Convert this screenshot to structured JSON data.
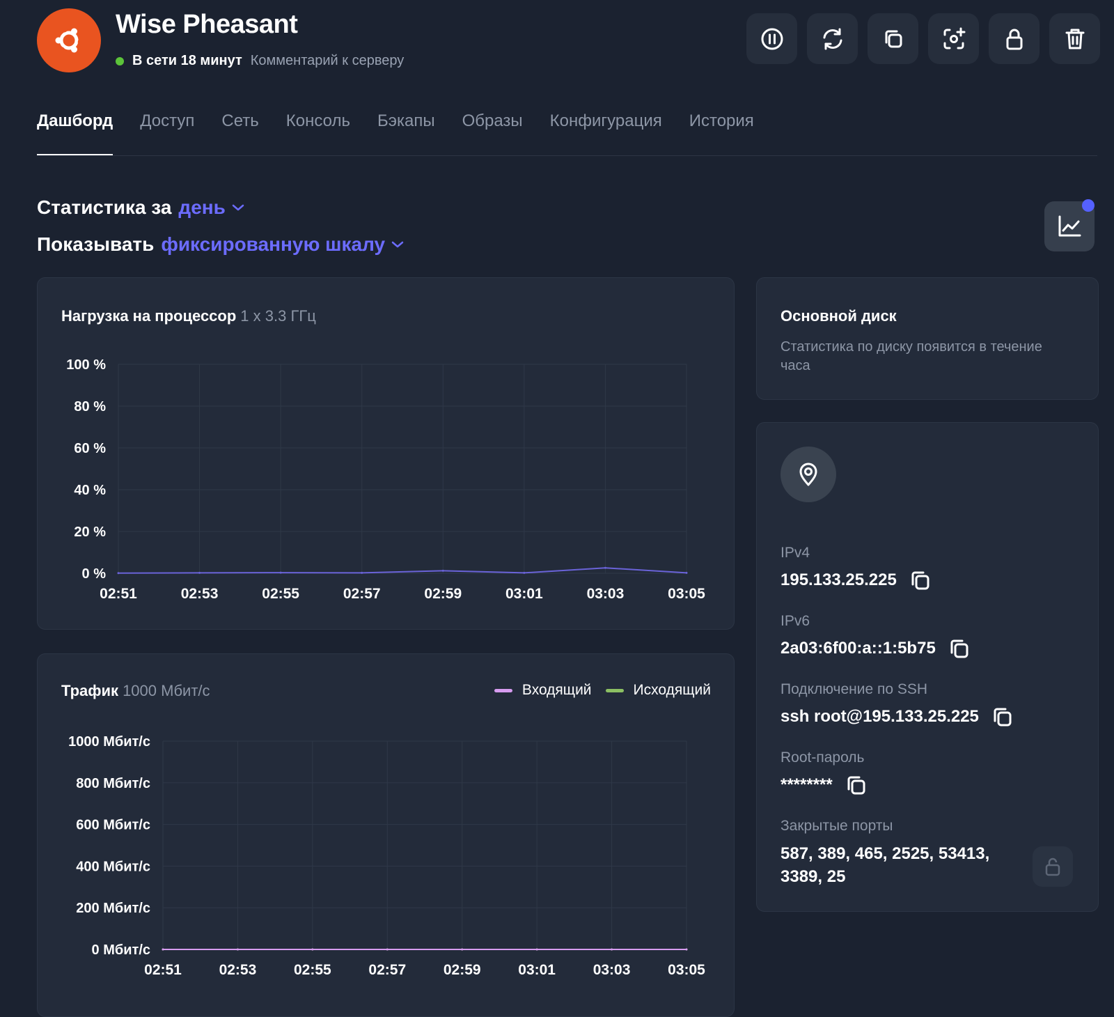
{
  "server": {
    "name": "Wise Pheasant",
    "status_text": "В сети 18 минут",
    "comment_link": "Комментарий к серверу",
    "os_icon": "ubuntu-icon",
    "os_color": "#e95420"
  },
  "toolbar": {
    "icons": [
      "pause-icon",
      "restart-icon",
      "clone-icon",
      "snapshot-icon",
      "lock-icon",
      "trash-icon"
    ]
  },
  "tabs": [
    {
      "label": "Дашборд",
      "active": true
    },
    {
      "label": "Доступ"
    },
    {
      "label": "Сеть"
    },
    {
      "label": "Консоль"
    },
    {
      "label": "Бэкапы"
    },
    {
      "label": "Образы"
    },
    {
      "label": "Конфигурация"
    },
    {
      "label": "История"
    }
  ],
  "filters": {
    "stats_prefix": "Статистика за",
    "stats_period": "день",
    "show_prefix": "Показывать",
    "show_mode": "фиксированную шкалу"
  },
  "colors": {
    "accent": "#6c6cff",
    "incoming": "#d79cf0",
    "outgoing": "#8cc063",
    "cpu_line": "#6a63d8",
    "status_online": "#5cc43a"
  },
  "cpu_card": {
    "title": "Нагрузка на процессор",
    "subtitle": "1 x 3.3 ГГц"
  },
  "traffic_card": {
    "title": "Трафик",
    "subtitle": "1000 Мбит/с",
    "legend_in": "Входящий",
    "legend_out": "Исходящий"
  },
  "chart_data": [
    {
      "type": "line",
      "title": "Нагрузка на процессор",
      "x": [
        "02:51",
        "02:53",
        "02:55",
        "02:57",
        "02:59",
        "03:01",
        "03:03",
        "03:05"
      ],
      "y_ticks": [
        "100 %",
        "80 %",
        "60 %",
        "40 %",
        "20 %",
        "0 %"
      ],
      "ylim": [
        0,
        100
      ],
      "grid": true,
      "series": [
        {
          "values": [
            0.1,
            0.2,
            0.3,
            0.2,
            1.2,
            0.2,
            2.6,
            0.2
          ]
        }
      ]
    },
    {
      "type": "line",
      "title": "Трафик",
      "x": [
        "02:51",
        "02:53",
        "02:55",
        "02:57",
        "02:59",
        "03:01",
        "03:03",
        "03:05"
      ],
      "y_ticks": [
        "1000 Мбит/с",
        "800 Мбит/с",
        "600 Мбит/с",
        "400 Мбит/с",
        "200 Мбит/с",
        "0 Мбит/с"
      ],
      "ylim": [
        0,
        1000
      ],
      "grid": true,
      "legend": "top-right",
      "series": [
        {
          "name": "Входящий",
          "values": [
            0,
            0,
            0,
            0,
            0,
            0,
            0,
            0
          ]
        },
        {
          "name": "Исходящий",
          "values": [
            0,
            0,
            0,
            0,
            0,
            0,
            0,
            0
          ]
        }
      ]
    }
  ],
  "disk_card": {
    "title": "Основной диск",
    "message": "Статистика по диску появится в течение часа"
  },
  "info_card": {
    "location_icon": "location-pin-icon",
    "ipv4_label": "IPv4",
    "ipv4": "195.133.25.225",
    "ipv6_label": "IPv6",
    "ipv6": "2a03:6f00:a::1:5b75",
    "ssh_label": "Подключение по SSH",
    "ssh": "ssh root@195.133.25.225",
    "root_label": "Root-пароль",
    "root_password": "********",
    "ports_label": "Закрытые порты",
    "ports_line1": "587, 389, 465, 2525, 53413,",
    "ports_line2": "3389, 25"
  }
}
